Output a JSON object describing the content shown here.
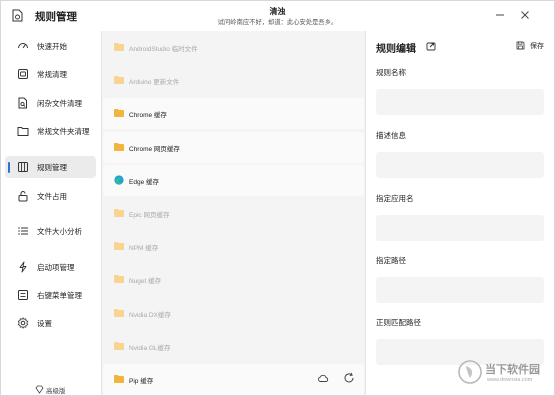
{
  "app": {
    "title": "规则管理",
    "center_title": "清浊",
    "center_subtitle": "试问岭南应不好，却道：此心安处是吾乡。"
  },
  "sidebar": {
    "items": [
      {
        "label": "快速开始",
        "icon": "gauge-icon",
        "active": false
      },
      {
        "label": "常规清理",
        "icon": "broom-box-icon",
        "active": false
      },
      {
        "label": "闲杂文件清理",
        "icon": "file-scan-icon",
        "active": false
      },
      {
        "label": "常规文件夹清理",
        "icon": "folder-icon",
        "active": false
      },
      {
        "label": "规则管理",
        "icon": "rules-grid-icon",
        "active": true
      },
      {
        "label": "文件占用",
        "icon": "lock-icon",
        "active": false
      },
      {
        "label": "文件大小分析",
        "icon": "list-icon",
        "active": false
      },
      {
        "label": "启动项管理",
        "icon": "lightning-icon",
        "active": false
      },
      {
        "label": "右键菜单管理",
        "icon": "context-menu-icon",
        "active": false
      },
      {
        "label": "设置",
        "icon": "gear-icon",
        "active": false
      }
    ],
    "advanced_label": "高级版"
  },
  "rules": {
    "items": [
      {
        "label": "AndroidStudio 临时文件",
        "enabled": false,
        "icon": "folder-icon"
      },
      {
        "label": "Arduino 更新文件",
        "enabled": false,
        "icon": "folder-icon"
      },
      {
        "label": "Chrome 缓存",
        "enabled": true,
        "icon": "folder-icon"
      },
      {
        "label": "Chrome 网页缓存",
        "enabled": true,
        "icon": "folder-icon"
      },
      {
        "label": "Edge 缓存",
        "enabled": true,
        "icon": "edge-icon"
      },
      {
        "label": "Epic 网页缓存",
        "enabled": false,
        "icon": "folder-icon"
      },
      {
        "label": "NPM 缓存",
        "enabled": false,
        "icon": "folder-icon"
      },
      {
        "label": "Nuget 缓存",
        "enabled": false,
        "icon": "folder-icon"
      },
      {
        "label": "Nvidia DX缓存",
        "enabled": false,
        "icon": "folder-icon"
      },
      {
        "label": "Nvidia GL缓存",
        "enabled": false,
        "icon": "folder-icon"
      },
      {
        "label": "Pip 缓存",
        "enabled": true,
        "icon": "folder-icon"
      }
    ]
  },
  "editor": {
    "title": "规则编辑",
    "save_label": "保存",
    "fields": [
      {
        "label": "规则名称",
        "value": ""
      },
      {
        "label": "描述信息",
        "value": ""
      },
      {
        "label": "指定应用名",
        "value": ""
      },
      {
        "label": "指定路径",
        "value": ""
      },
      {
        "label": "正则匹配路径",
        "value": ""
      }
    ]
  },
  "watermark": {
    "text": "当下软件园",
    "url": "www.downxia.com"
  },
  "colors": {
    "accent": "#2f6fd6",
    "folder_enabled": "#f2b43c",
    "folder_disabled": "#f7d591"
  }
}
